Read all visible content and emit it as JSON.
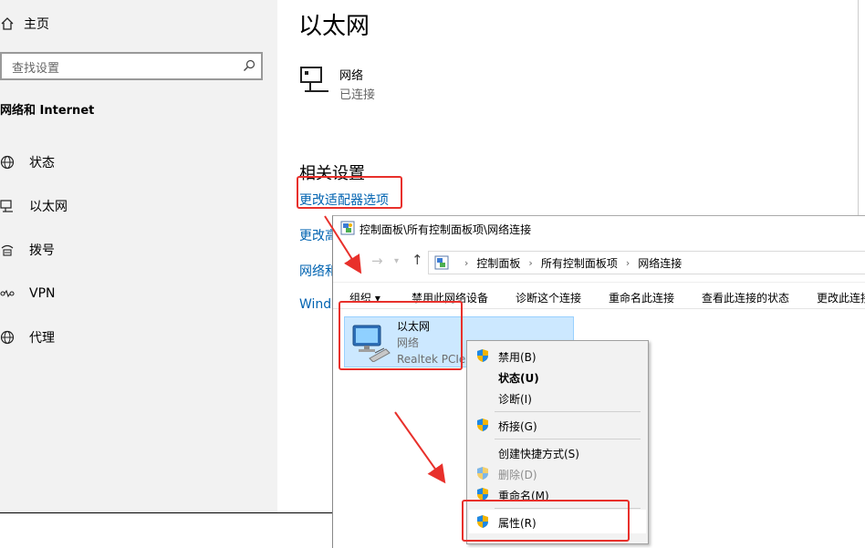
{
  "settings": {
    "home_label": "主页",
    "search_placeholder": "查找设置",
    "section_title": "网络和 Internet",
    "nav": [
      {
        "label": "状态",
        "icon": "globe-status-icon"
      },
      {
        "label": "以太网",
        "icon": "ethernet-icon"
      },
      {
        "label": "拨号",
        "icon": "dialup-icon"
      },
      {
        "label": "VPN",
        "icon": "vpn-icon"
      },
      {
        "label": "代理",
        "icon": "globe-icon"
      }
    ],
    "page_title": "以太网",
    "network_name": "网络",
    "network_status": "已连接",
    "related_title": "相关设置",
    "links": [
      "更改适配器选项",
      "更改高",
      "网络和",
      "Windo"
    ]
  },
  "explorer": {
    "title": "控制面板\\所有控制面板项\\网络连接",
    "breadcrumb": [
      "控制面板",
      "所有控制面板项",
      "网络连接"
    ],
    "toolbar": [
      "组织 ▾",
      "禁用此网络设备",
      "诊断这个连接",
      "重命名此连接",
      "查看此连接的状态",
      "更改此连接"
    ],
    "item": {
      "name": "以太网",
      "network": "网络",
      "adapter": "Realtek PCIe"
    }
  },
  "context_menu": {
    "items": [
      {
        "label": "禁用(B)",
        "shield": true,
        "style": "normal"
      },
      {
        "label": "状态(U)",
        "shield": false,
        "style": "bold"
      },
      {
        "label": "诊断(I)",
        "shield": false,
        "style": "normal"
      },
      {
        "label": "桥接(G)",
        "shield": true,
        "style": "normal"
      },
      {
        "label": "创建快捷方式(S)",
        "shield": false,
        "style": "normal"
      },
      {
        "label": "删除(D)",
        "shield": true,
        "style": "disabled"
      },
      {
        "label": "重命名(M)",
        "shield": true,
        "style": "normal"
      },
      {
        "label": "属性(R)",
        "shield": true,
        "style": "normal"
      }
    ]
  },
  "colors": {
    "link": "#0063b1",
    "annotation_red": "#e8302b",
    "selection": "#cce8ff"
  }
}
